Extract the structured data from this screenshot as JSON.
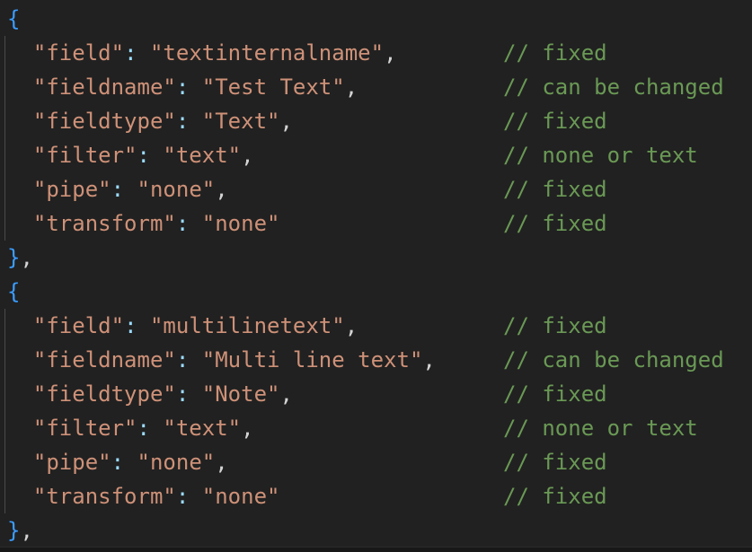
{
  "editor": {
    "language": "json",
    "background_color": "#212121",
    "indent_guide_color": "#4a4a4a",
    "colors": {
      "brace": "#3b9dff",
      "punctuation": "#d4d4d4",
      "colon": "#9cdcfe",
      "string": "#ce9178",
      "key": "#ce9178",
      "comment": "#6a9955"
    },
    "quote": "\"",
    "colon": ":",
    "comma": ",",
    "open_brace": "{",
    "close_brace": "}",
    "comment_prefix": "//"
  },
  "lines": [
    {
      "kind": "open",
      "indented": false,
      "text": "{",
      "comment": ""
    },
    {
      "kind": "pair",
      "indented": true,
      "key": "field",
      "value": "textinternalname",
      "trailing": ",",
      "text": "  \"field\": \"textinternalname\",",
      "comment": "// fixed"
    },
    {
      "kind": "pair",
      "indented": true,
      "key": "fieldname",
      "value": "Test Text",
      "trailing": ",",
      "text": "  \"fieldname\": \"Test Text\",",
      "comment": "// can be changed"
    },
    {
      "kind": "pair",
      "indented": true,
      "key": "fieldtype",
      "value": "Text",
      "trailing": ",",
      "text": "  \"fieldtype\": \"Text\",",
      "comment": "// fixed"
    },
    {
      "kind": "pair",
      "indented": true,
      "key": "filter",
      "value": "text",
      "trailing": ",",
      "text": "  \"filter\": \"text\",",
      "comment": "// none or text"
    },
    {
      "kind": "pair",
      "indented": true,
      "key": "pipe",
      "value": "none",
      "trailing": ",",
      "text": "  \"pipe\": \"none\",",
      "comment": "// fixed"
    },
    {
      "kind": "pair",
      "indented": true,
      "key": "transform",
      "value": "none",
      "trailing": "",
      "text": "  \"transform\": \"none\"",
      "comment": "// fixed"
    },
    {
      "kind": "close",
      "indented": false,
      "text": "},",
      "comment": ""
    },
    {
      "kind": "open",
      "indented": false,
      "text": "{",
      "comment": ""
    },
    {
      "kind": "pair",
      "indented": true,
      "key": "field",
      "value": "multilinetext",
      "trailing": ",",
      "text": "  \"field\": \"multilinetext\",",
      "comment": "// fixed"
    },
    {
      "kind": "pair",
      "indented": true,
      "key": "fieldname",
      "value": "Multi line text",
      "trailing": ",",
      "text": "  \"fieldname\": \"Multi line text\",",
      "comment": "// can be changed"
    },
    {
      "kind": "pair",
      "indented": true,
      "key": "fieldtype",
      "value": "Note",
      "trailing": ",",
      "text": "  \"fieldtype\": \"Note\",",
      "comment": "// fixed"
    },
    {
      "kind": "pair",
      "indented": true,
      "key": "filter",
      "value": "text",
      "trailing": ",",
      "text": "  \"filter\": \"text\",",
      "comment": "// none or text"
    },
    {
      "kind": "pair",
      "indented": true,
      "key": "pipe",
      "value": "none",
      "trailing": ",",
      "text": "  \"pipe\": \"none\",",
      "comment": "// fixed"
    },
    {
      "kind": "pair",
      "indented": true,
      "key": "transform",
      "value": "none",
      "trailing": "",
      "text": "  \"transform\": \"none\"",
      "comment": "// fixed"
    },
    {
      "kind": "close",
      "indented": false,
      "text": "},",
      "comment": ""
    }
  ]
}
